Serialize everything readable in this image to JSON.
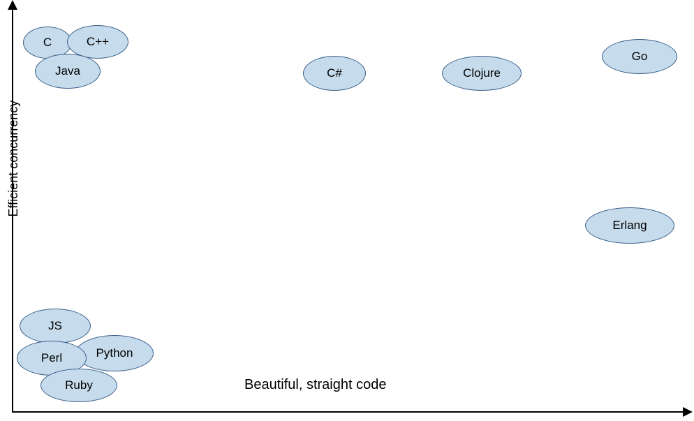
{
  "chart_data": {
    "type": "scatter",
    "title": "",
    "xlabel": "Beautiful, straight code",
    "ylabel": "Efficient concurrency",
    "xlim": [
      0,
      10
    ],
    "ylim": [
      0,
      10
    ],
    "series": [
      {
        "name": "C",
        "x": 0.5,
        "y": 9.4
      },
      {
        "name": "C++",
        "x": 1.2,
        "y": 9.5
      },
      {
        "name": "Java",
        "x": 0.8,
        "y": 8.7
      },
      {
        "name": "C#",
        "x": 4.8,
        "y": 8.6
      },
      {
        "name": "Clojure",
        "x": 6.9,
        "y": 8.6
      },
      {
        "name": "Go",
        "x": 9.4,
        "y": 9.0
      },
      {
        "name": "Erlang",
        "x": 9.2,
        "y": 4.8
      },
      {
        "name": "JS",
        "x": 0.6,
        "y": 2.4
      },
      {
        "name": "Python",
        "x": 1.5,
        "y": 1.7
      },
      {
        "name": "Perl",
        "x": 0.6,
        "y": 1.5
      },
      {
        "name": "Ruby",
        "x": 1.1,
        "y": 0.8
      }
    ]
  },
  "labels": {
    "c": "C",
    "cpp": "C++",
    "java": "Java",
    "cs": "C#",
    "clojure": "Clojure",
    "go": "Go",
    "erlang": "Erlang",
    "js": "JS",
    "python": "Python",
    "perl": "Perl",
    "ruby": "Ruby"
  }
}
